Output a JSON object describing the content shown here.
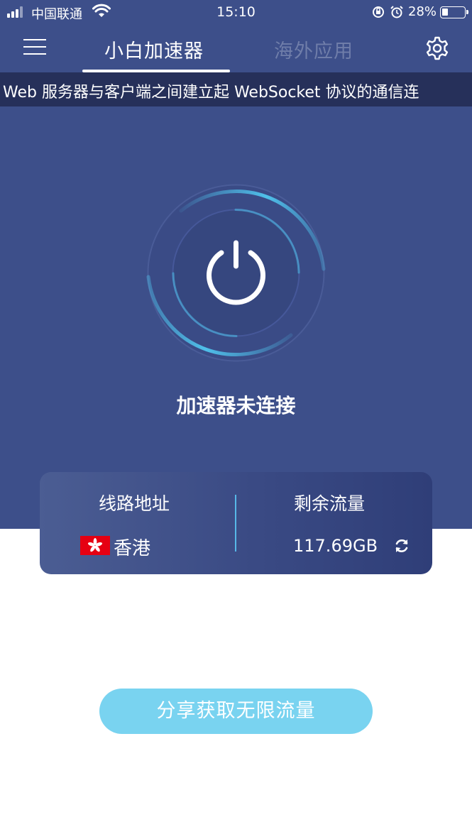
{
  "status_bar": {
    "carrier": "中国联通",
    "time": "15:10",
    "battery_percent": "28%",
    "battery_level": 0.28,
    "icons": [
      "signal-icon",
      "wifi-icon",
      "rotation-lock-icon",
      "alarm-icon",
      "battery-icon"
    ]
  },
  "header": {
    "menu_icon": "menu-icon",
    "tabs": [
      {
        "label": "小白加速器",
        "active": true
      },
      {
        "label": "海外应用",
        "active": false
      }
    ],
    "settings_icon": "gear-icon"
  },
  "ticker": {
    "text": "Web 服务器与客户端之间建立起 WebSocket 协议的通信连"
  },
  "power": {
    "icon": "power-icon",
    "status_text": "加速器未连接"
  },
  "info_card": {
    "route_label": "线路地址",
    "route_flag": "hong-kong-flag-icon",
    "route_value": "香港",
    "traffic_label": "剩余流量",
    "traffic_value": "117.69GB",
    "refresh_icon": "refresh-icon"
  },
  "share_button": {
    "label": "分享获取无限流量"
  },
  "colors": {
    "header_bg": "#3d4f8a",
    "ticker_bg": "#26305a",
    "accent": "#4fc0ea",
    "share_button": "#79d3f0",
    "inactive_tab": "#6f7da9"
  }
}
